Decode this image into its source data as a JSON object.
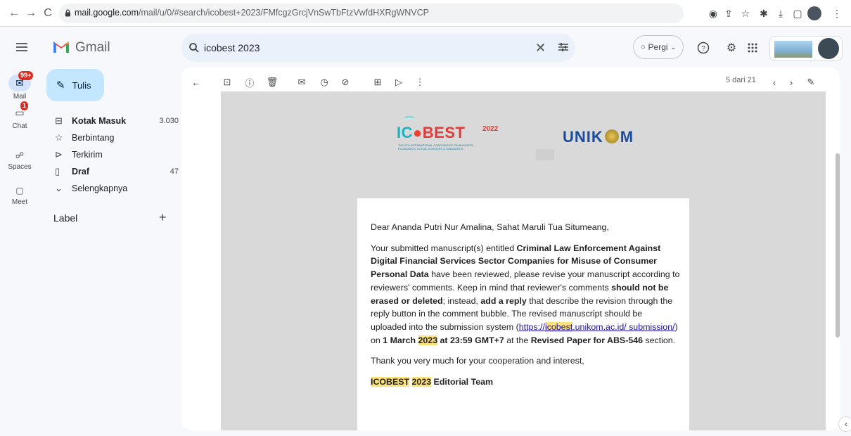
{
  "browser": {
    "url_host": "mail.google.com",
    "url_path": "/mail/u/0/#search/icobest+2023/FMfcgzGrcjVnSwTbFtzVwfdHXRgWNVCP"
  },
  "gmail": {
    "app_name": "Gmail",
    "search_query": "icobest 2023",
    "status_label": "Pergi"
  },
  "rail": {
    "mail": {
      "label": "Mail",
      "badge": "99+"
    },
    "chat": {
      "label": "Chat",
      "badge": "1"
    },
    "spaces": {
      "label": "Spaces"
    },
    "meet": {
      "label": "Meet"
    }
  },
  "compose_label": "Tulis",
  "folders": [
    {
      "label": "Kotak Masuk",
      "count": "3.030",
      "icon": "inbox-icon"
    },
    {
      "label": "Berbintang",
      "count": "",
      "icon": "star-icon"
    },
    {
      "label": "Terkirim",
      "count": "",
      "icon": "send-icon"
    },
    {
      "label": "Draf",
      "count": "47",
      "icon": "draft-icon"
    },
    {
      "label": "Selengkapnya",
      "count": "",
      "icon": "chevron-down-icon"
    }
  ],
  "labels_header": "Label",
  "pager": "5 dari 21",
  "logos": {
    "icobest": {
      "brand": "IC",
      "brand2": "BEST",
      "year": "2022",
      "tagline1": "THE 4TH INTERNATIONAL CONFERENCE ON BUSINESS,",
      "tagline2": "ECONOMICS, SOCIAL SCIENCES & HUMANITIES"
    },
    "unikom": {
      "part1": "UNIK",
      "part2": "M"
    }
  },
  "email": {
    "greeting": "Dear Ananda Putri Nur Amalina, Sahat Maruli Tua Situmeang,",
    "p1_a": "Your submitted manuscript(s) entitled ",
    "p1_title": "Criminal Law Enforcement Against Digital Financial Services Sector Companies for Misuse of Consumer Personal Data",
    "p1_b": " have been reviewed, please revise your manuscript according to reviewers' comments. Keep in mind that reviewer's comments ",
    "p1_c": "should not be erased or deleted",
    "p1_d": "; instead, ",
    "p1_e": "add a reply",
    "p1_f": " that describe the revision through the reply button in the comment bubble. The revised manuscript should be uploaded into the submission system (",
    "link_a": "https://",
    "link_hl": "icobest",
    "link_b": ".unikom.ac.id/ submission/",
    "p1_g": ") on ",
    "date_a": "1 March ",
    "date_year": "2023",
    "date_b": " at 23:59 GMT+7",
    "p1_h": " at the ",
    "section": "Revised Paper for ABS-546",
    "p1_i": " section.",
    "thanks": "Thank you very much for your cooperation and interest,",
    "sign_a": "ICOBEST",
    "sign_year": "2023",
    "sign_b": " Editorial Team"
  }
}
